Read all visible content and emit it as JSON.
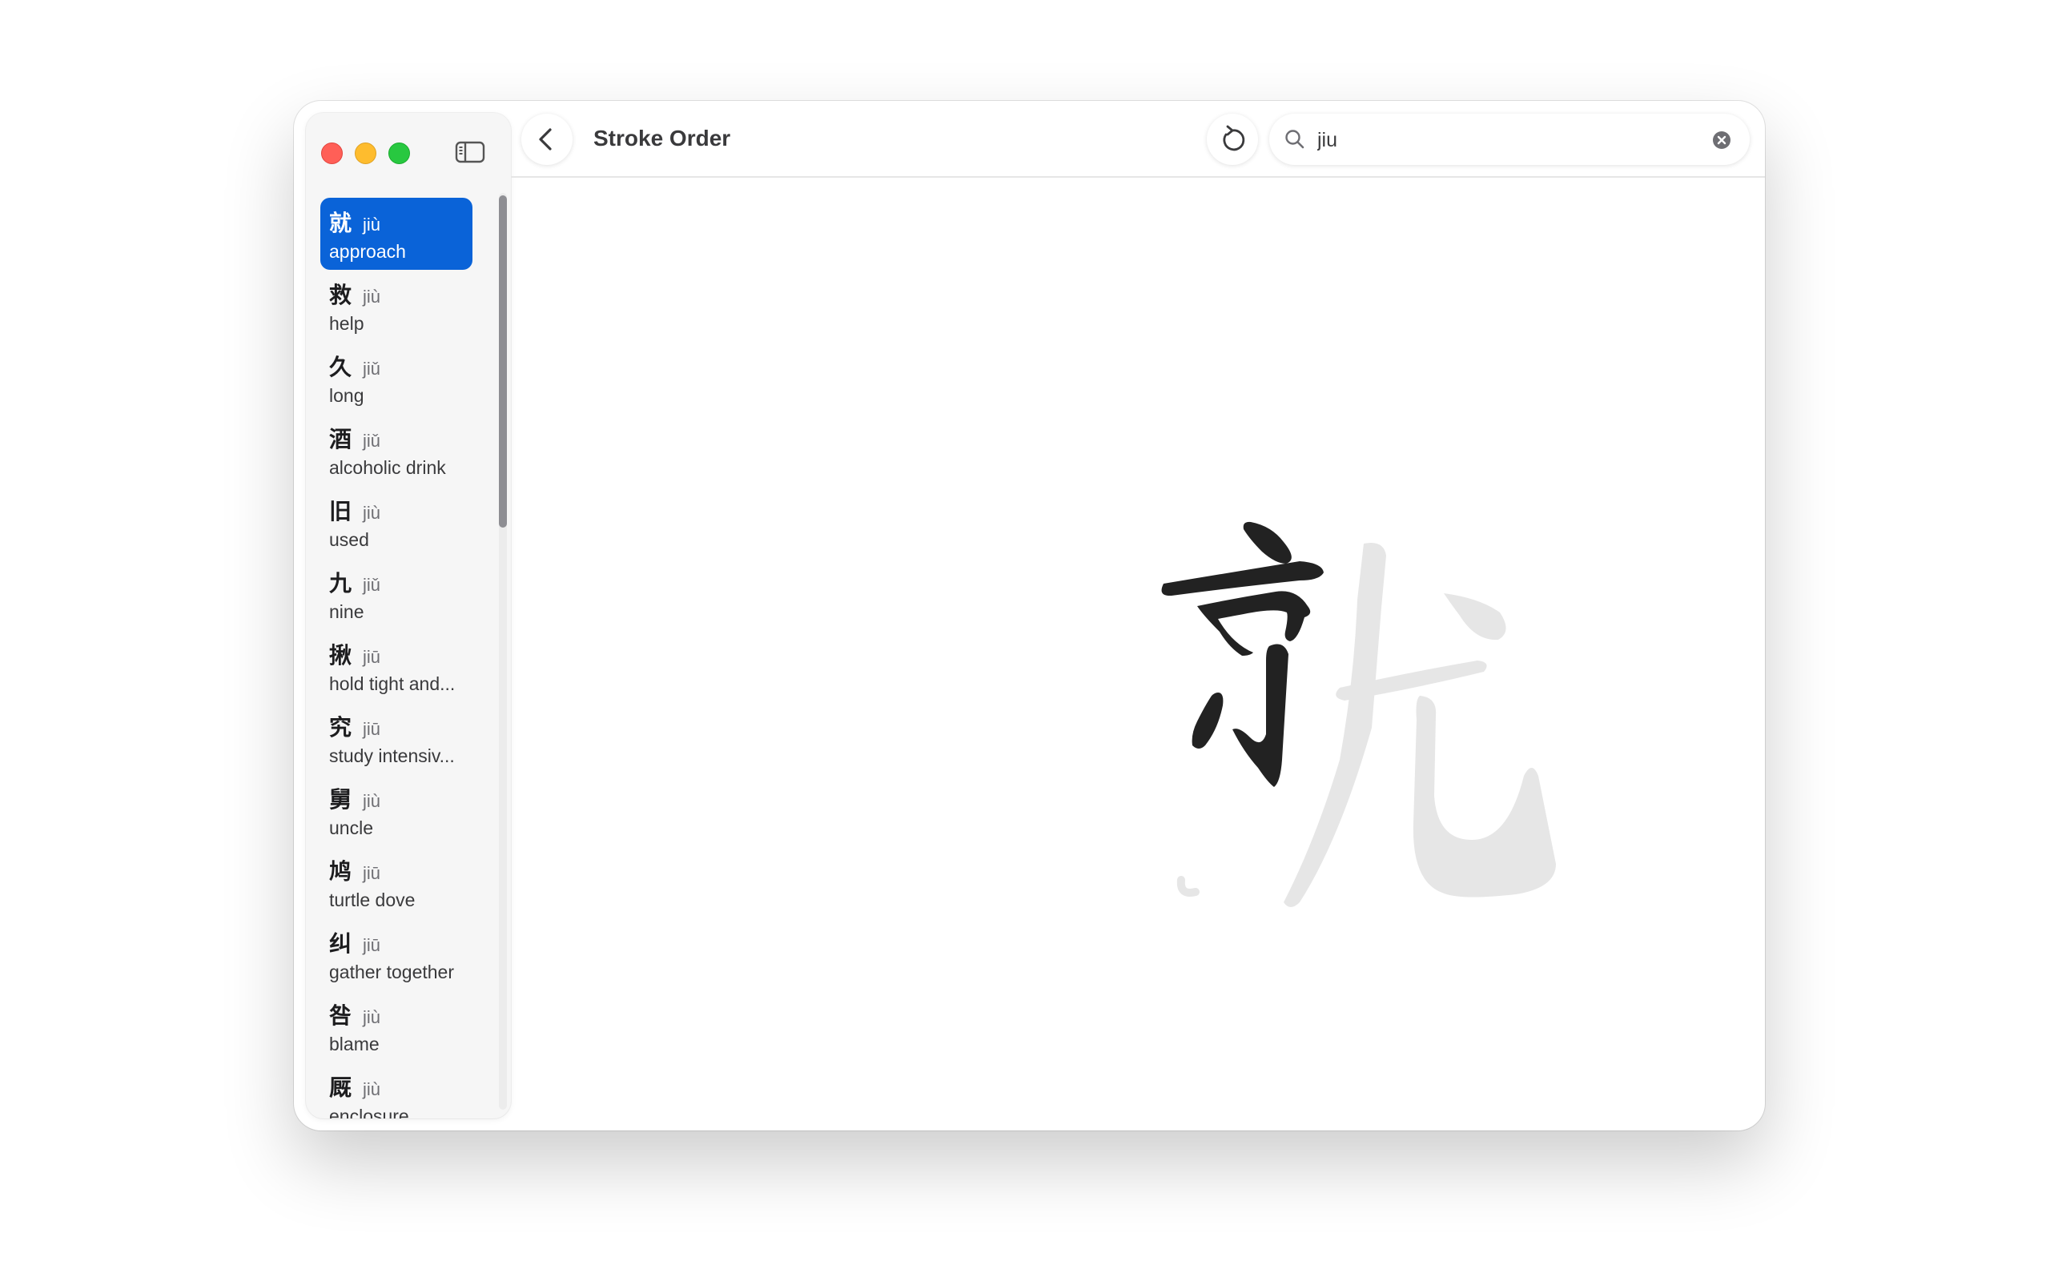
{
  "app": {
    "title": "Stroke Order"
  },
  "search": {
    "value": "jiu"
  },
  "current_character": "就",
  "sidebar": {
    "items": [
      {
        "hanzi": "就",
        "pinyin": "jiù",
        "meaning": "approach",
        "selected": true
      },
      {
        "hanzi": "救",
        "pinyin": "jiù",
        "meaning": "help"
      },
      {
        "hanzi": "久",
        "pinyin": "jiǔ",
        "meaning": "long"
      },
      {
        "hanzi": "酒",
        "pinyin": "jiǔ",
        "meaning": "alcoholic drink"
      },
      {
        "hanzi": "旧",
        "pinyin": "jiù",
        "meaning": "used"
      },
      {
        "hanzi": "九",
        "pinyin": "jiǔ",
        "meaning": "nine"
      },
      {
        "hanzi": "揪",
        "pinyin": "jiū",
        "meaning": "hold tight and..."
      },
      {
        "hanzi": "究",
        "pinyin": "jiū",
        "meaning": "study intensiv..."
      },
      {
        "hanzi": "舅",
        "pinyin": "jiù",
        "meaning": "uncle"
      },
      {
        "hanzi": "鸠",
        "pinyin": "jiū",
        "meaning": "turtle dove"
      },
      {
        "hanzi": "纠",
        "pinyin": "jiū",
        "meaning": "gather together"
      },
      {
        "hanzi": "咎",
        "pinyin": "jiù",
        "meaning": "blame"
      },
      {
        "hanzi": "厩",
        "pinyin": "jiù",
        "meaning": "enclosure"
      }
    ]
  },
  "colors": {
    "accent": "#0a63d8",
    "stroke_done": "#222222",
    "stroke_pending": "#e6e6e6"
  },
  "icons": {
    "back": "chevron-left-icon",
    "sidebar": "sidebar-toggle-icon",
    "reset": "replay-icon",
    "search": "search-icon",
    "clear": "clear-icon"
  }
}
